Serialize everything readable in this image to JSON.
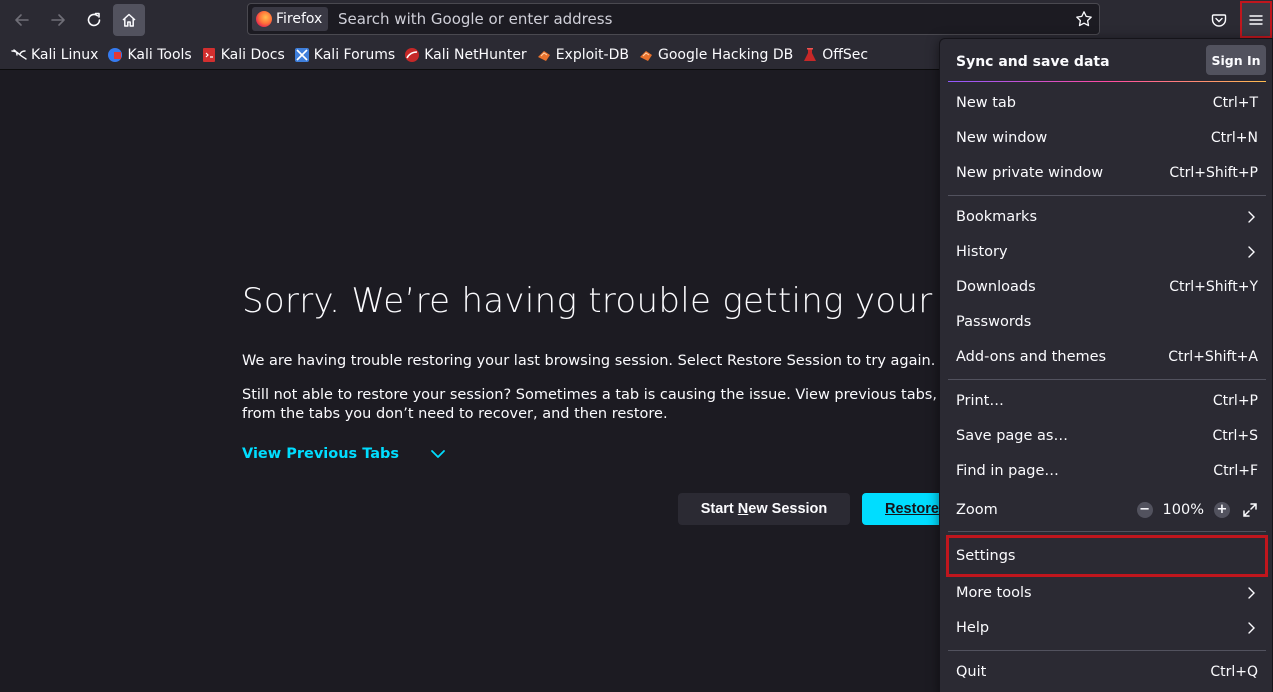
{
  "browser": {
    "identity_label": "Firefox",
    "url_placeholder": "Search with Google or enter address"
  },
  "bookmarks": [
    {
      "label": "Kali Linux",
      "icon": "kali-dragon-icon"
    },
    {
      "label": "Kali Tools",
      "icon": "kali-tools-icon"
    },
    {
      "label": "Kali Docs",
      "icon": "kali-docs-icon"
    },
    {
      "label": "Kali Forums",
      "icon": "kali-forums-icon"
    },
    {
      "label": "Kali NetHunter",
      "icon": "kali-nethunter-icon"
    },
    {
      "label": "Exploit-DB",
      "icon": "exploit-db-icon"
    },
    {
      "label": "Google Hacking DB",
      "icon": "ghdb-icon"
    },
    {
      "label": "OffSec",
      "icon": "offsec-icon"
    }
  ],
  "restore_page": {
    "title": "Sorry. We’re having trouble getting your pages b",
    "para1": "We are having trouble restoring your last browsing session. Select Restore Session to try again.",
    "para2_line1": "Still not able to restore your session? Sometimes a tab is causing the issue. View previous tabs, remove th",
    "para2_line2": "from the tabs you don’t need to recover, and then restore.",
    "view_previous_tabs": "View Previous Tabs",
    "start_new_session_pre": "Start ",
    "start_new_session_key": "N",
    "start_new_session_post": "ew Session",
    "restore_label": "Restore"
  },
  "app_menu": {
    "sync_title": "Sync and save data",
    "sign_in": "Sign In",
    "items": {
      "new_tab": {
        "label": "New tab",
        "shortcut": "Ctrl+T"
      },
      "new_window": {
        "label": "New window",
        "shortcut": "Ctrl+N"
      },
      "new_private_window": {
        "label": "New private window",
        "shortcut": "Ctrl+Shift+P"
      },
      "bookmarks": {
        "label": "Bookmarks"
      },
      "history": {
        "label": "History"
      },
      "downloads": {
        "label": "Downloads",
        "shortcut": "Ctrl+Shift+Y"
      },
      "passwords": {
        "label": "Passwords"
      },
      "addons": {
        "label": "Add-ons and themes",
        "shortcut": "Ctrl+Shift+A"
      },
      "print": {
        "label": "Print…",
        "shortcut": "Ctrl+P"
      },
      "save_page": {
        "label": "Save page as…",
        "shortcut": "Ctrl+S"
      },
      "find": {
        "label": "Find in page…",
        "shortcut": "Ctrl+F"
      },
      "zoom": {
        "label": "Zoom",
        "value": "100%",
        "minus": "−",
        "plus": "+"
      },
      "settings": {
        "label": "Settings"
      },
      "more_tools": {
        "label": "More tools"
      },
      "help": {
        "label": "Help"
      },
      "quit": {
        "label": "Quit",
        "shortcut": "Ctrl+Q"
      }
    }
  },
  "colors": {
    "accent": "#00ddff",
    "highlight": "#c0161d",
    "toolbar": "#2b2a33",
    "background": "#1c1b22"
  }
}
